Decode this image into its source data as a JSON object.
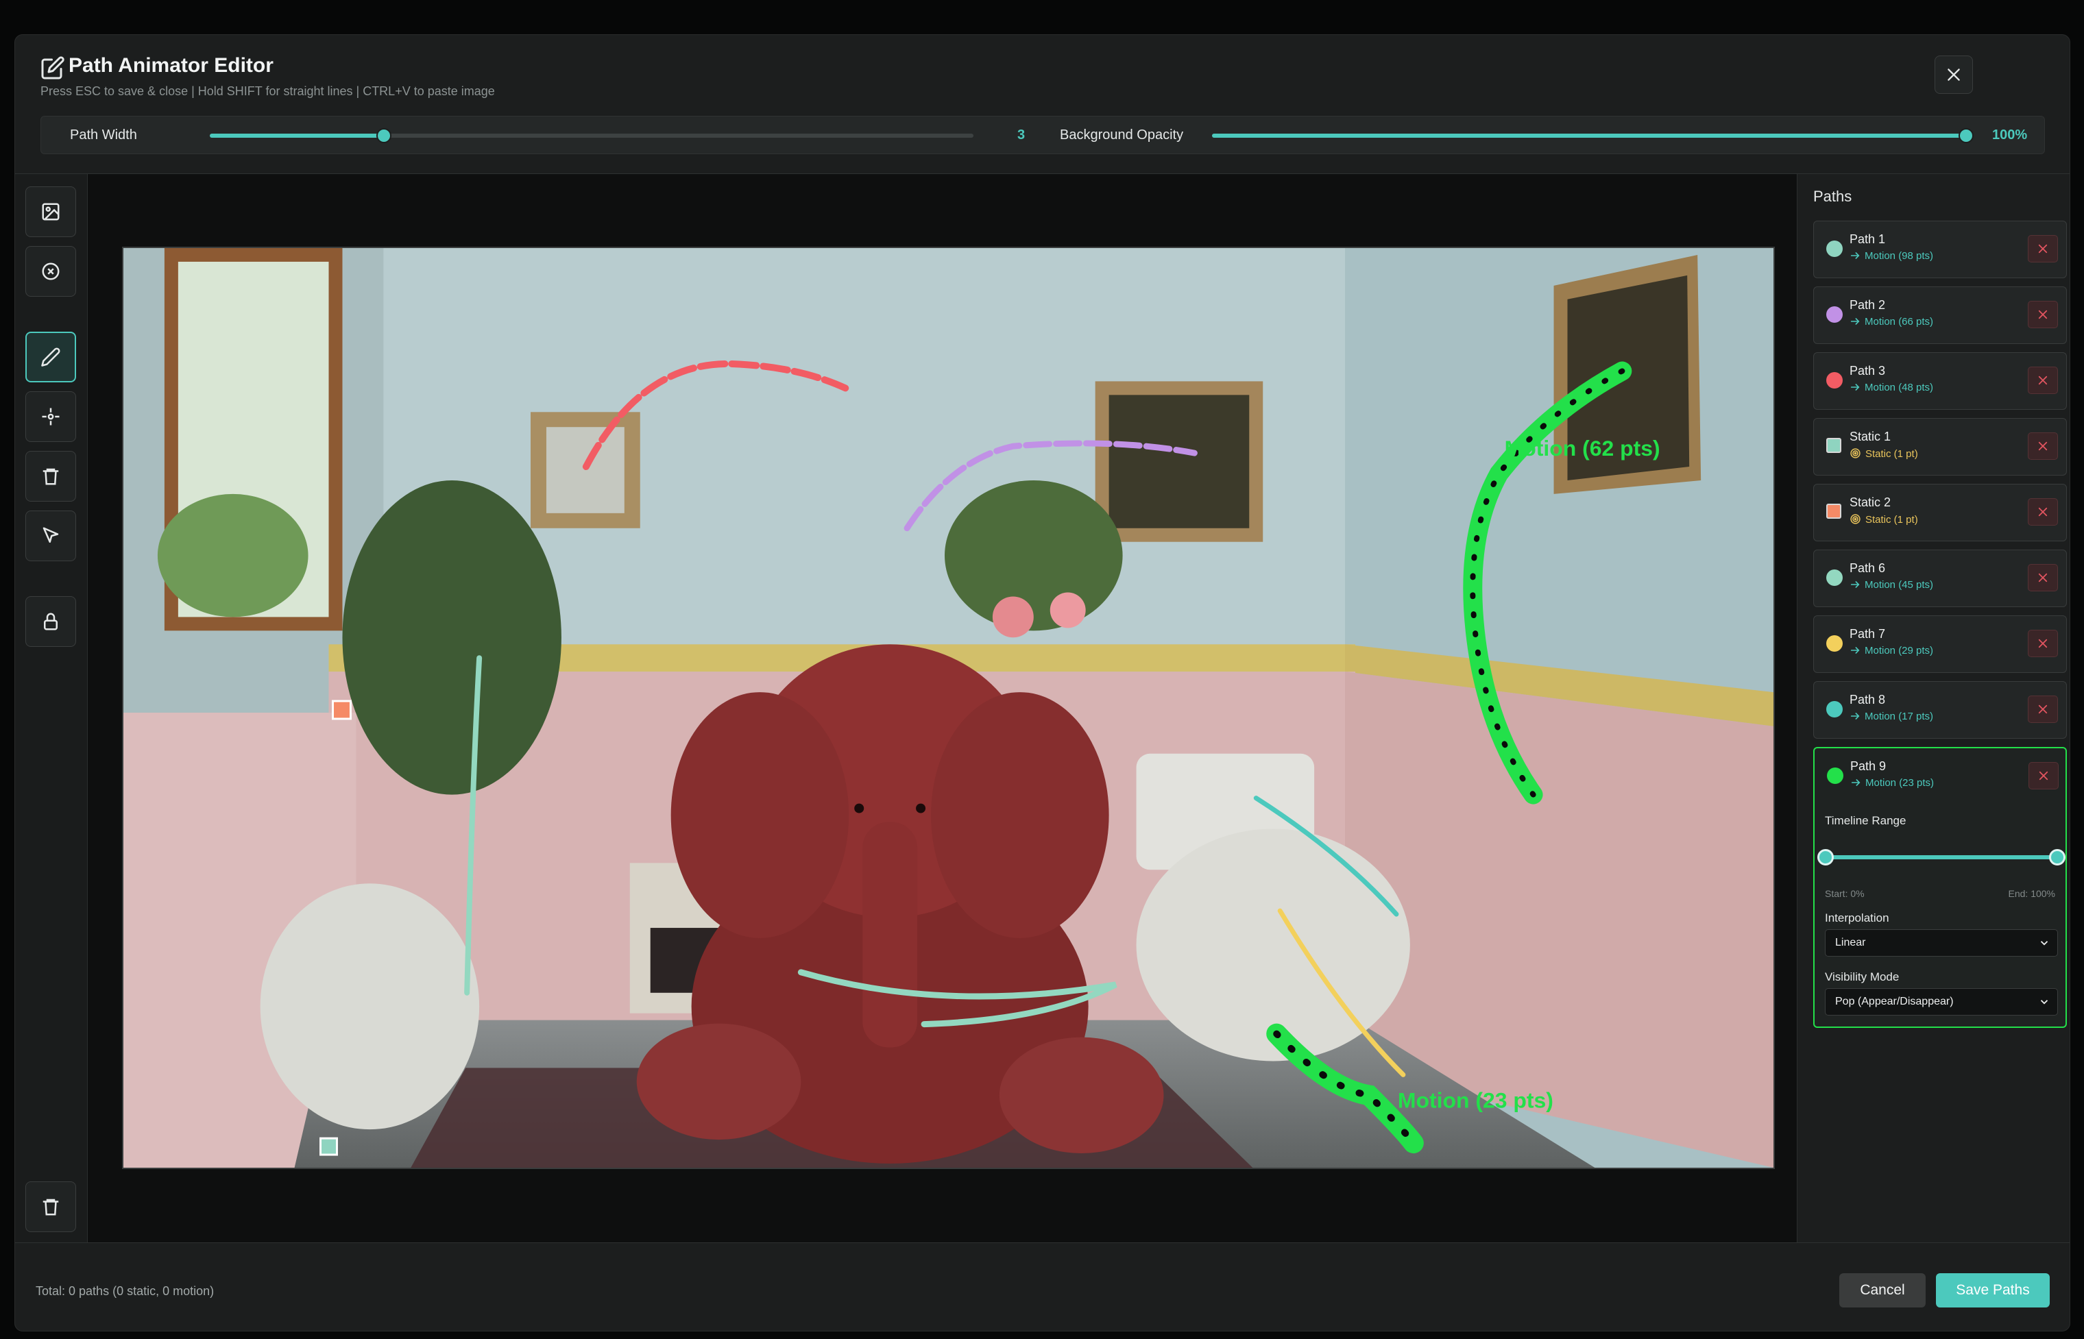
{
  "header": {
    "title": "Path Animator Editor",
    "subtitle": "Press ESC to save & close | Hold SHIFT for straight lines | CTRL+V to paste image"
  },
  "controls": {
    "path_width": {
      "label": "Path Width",
      "value": "3",
      "fraction": 0.228
    },
    "bg_opacity": {
      "label": "Background Opacity",
      "value": "100%",
      "fraction": 1.0
    }
  },
  "canvas": {
    "labels": [
      {
        "text": "Motion (62 pts)",
        "color": "#23e04a"
      },
      {
        "text": "Motion (23 pts)",
        "color": "#23e04a"
      }
    ]
  },
  "sidebar": {
    "title": "Paths",
    "items": [
      {
        "name": "Path 1",
        "detail": "Motion (98 pts)",
        "kind": "motion",
        "color": "#8fd4c0"
      },
      {
        "name": "Path 2",
        "detail": "Motion (66 pts)",
        "kind": "motion",
        "color": "#c191e6"
      },
      {
        "name": "Path 3",
        "detail": "Motion (48 pts)",
        "kind": "motion",
        "color": "#f25c64"
      },
      {
        "name": "Static 1",
        "detail": "Static (1 pt)",
        "kind": "static",
        "color": "#8fd4c0"
      },
      {
        "name": "Static 2",
        "detail": "Static (1 pt)",
        "kind": "static",
        "color": "#f58a66"
      },
      {
        "name": "Path 6",
        "detail": "Motion (45 pts)",
        "kind": "motion",
        "color": "#93d8c0"
      },
      {
        "name": "Path 7",
        "detail": "Motion (29 pts)",
        "kind": "motion",
        "color": "#f3d05c"
      },
      {
        "name": "Path 8",
        "detail": "Motion (17 pts)",
        "kind": "motion",
        "color": "#4cc9bd"
      },
      {
        "name": "Path 9",
        "detail": "Motion (23 pts)",
        "kind": "motion",
        "color": "#23e04a"
      }
    ],
    "selected": {
      "timeline_label": "Timeline Range",
      "start_text": "Start: 0%",
      "end_text": "End: 100%",
      "start": 0,
      "end": 1,
      "interpolation_label": "Interpolation",
      "interpolation_value": "Linear",
      "visibility_label": "Visibility Mode",
      "visibility_value": "Pop (Appear/Disappear)"
    }
  },
  "footer": {
    "total": "Total: 0 paths (0 static, 0 motion)",
    "cancel": "Cancel",
    "save": "Save Paths"
  },
  "colors": {
    "accent": "#4cc9bd",
    "selected": "#23e04a",
    "danger": "#e25560"
  }
}
